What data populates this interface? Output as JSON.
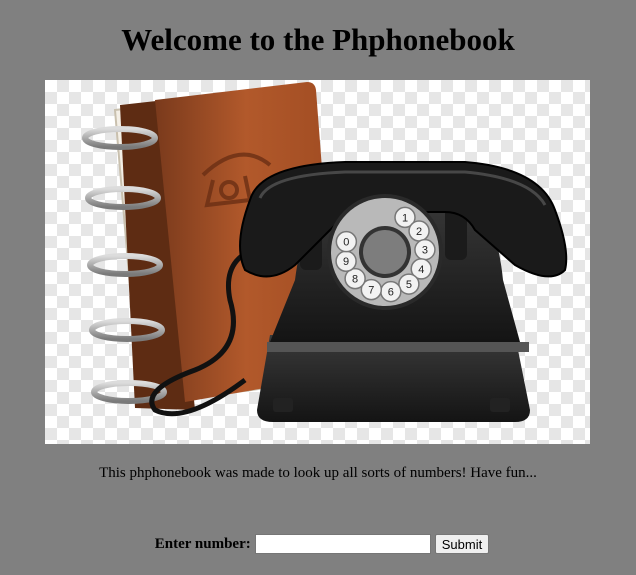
{
  "page": {
    "heading": "Welcome to the Phphonebook",
    "tagline": "This phphonebook was made to look up all sorts of numbers! Have fun...",
    "background_color": "#808080"
  },
  "hero": {
    "icon": "phonebook-and-rotary-telephone",
    "dial_digits": [
      "1",
      "2",
      "3",
      "4",
      "5",
      "6",
      "7",
      "8",
      "9",
      "0"
    ]
  },
  "form": {
    "number_label": "Enter number:",
    "number_value": "",
    "submit_label": "Submit"
  }
}
